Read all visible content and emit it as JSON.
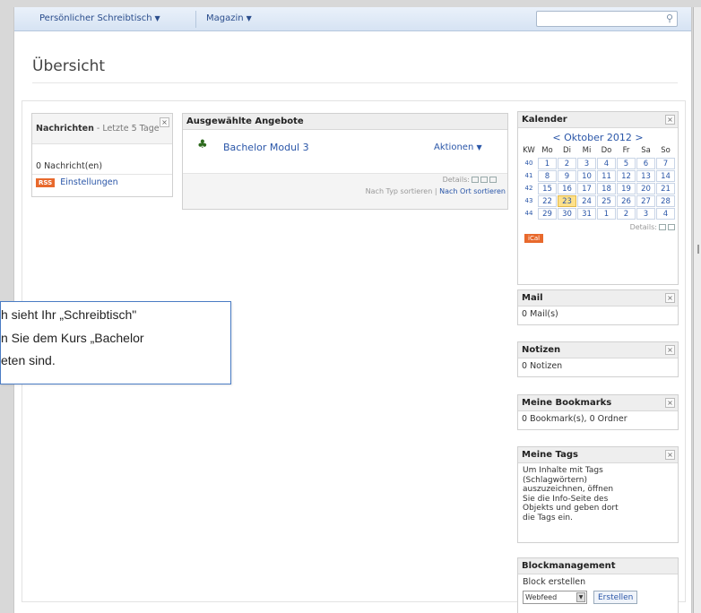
{
  "nav": {
    "desk": "Persönlicher Schreibtisch",
    "magazine": "Magazin",
    "search_placeholder": ""
  },
  "page": {
    "title": "Übersicht"
  },
  "news": {
    "title": "Nachrichten",
    "subtitle": "- Letzte 5 Tage",
    "count": "0 Nachricht(en)",
    "rss": "RSS",
    "settings": "Einstellungen"
  },
  "offers": {
    "title": "Ausgewählte Angebote",
    "item": "Bachelor Modul 3",
    "actions": "Aktionen",
    "details": "Details:",
    "sort_type": "Nach Typ sortieren",
    "sort_sep": "|",
    "sort_place": "Nach Ort sortieren"
  },
  "calendar": {
    "title": "Kalender",
    "prev": "<",
    "month": "Oktober 2012",
    "next": ">",
    "headers": [
      "KW",
      "Mo",
      "Di",
      "Mi",
      "Do",
      "Fr",
      "Sa",
      "So"
    ],
    "weeks": [
      {
        "kw": "40",
        "days": [
          "1",
          "2",
          "3",
          "4",
          "5",
          "6",
          "7"
        ]
      },
      {
        "kw": "41",
        "days": [
          "8",
          "9",
          "10",
          "11",
          "12",
          "13",
          "14"
        ]
      },
      {
        "kw": "42",
        "days": [
          "15",
          "16",
          "17",
          "18",
          "19",
          "20",
          "21"
        ]
      },
      {
        "kw": "43",
        "days": [
          "22",
          "23",
          "24",
          "25",
          "26",
          "27",
          "28"
        ]
      },
      {
        "kw": "44",
        "days": [
          "29",
          "30",
          "31",
          "1",
          "2",
          "3",
          "4"
        ]
      }
    ],
    "today": "23",
    "details": "Details:",
    "ical": "iCal"
  },
  "mail": {
    "title": "Mail",
    "count": "0 Mail(s)"
  },
  "notes": {
    "title": "Notizen",
    "count": "0 Notizen"
  },
  "bookmarks": {
    "title": "Meine Bookmarks",
    "count": "0 Bookmark(s), 0 Ordner"
  },
  "tags": {
    "title": "Meine Tags",
    "lines": [
      "Um Inhalte mit Tags",
      "(Schlagwörtern)",
      "auszuzeichnen, öffnen",
      "Sie die Info-Seite des",
      "Objekts und geben dort",
      "die Tags ein."
    ]
  },
  "blockmgmt": {
    "title": "Blockmanagement",
    "label": "Block erstellen",
    "select_value": "Webfeed",
    "button": "Erstellen"
  },
  "tooltip": {
    "line1": "h sieht Ihr „Schreibtisch\"",
    "line2": "n Sie dem Kurs „Bachelor",
    "line3": "eten sind."
  },
  "colors": {
    "accent": "#2a56a8",
    "rss": "#e8692c",
    "today": "#ffe18a"
  }
}
